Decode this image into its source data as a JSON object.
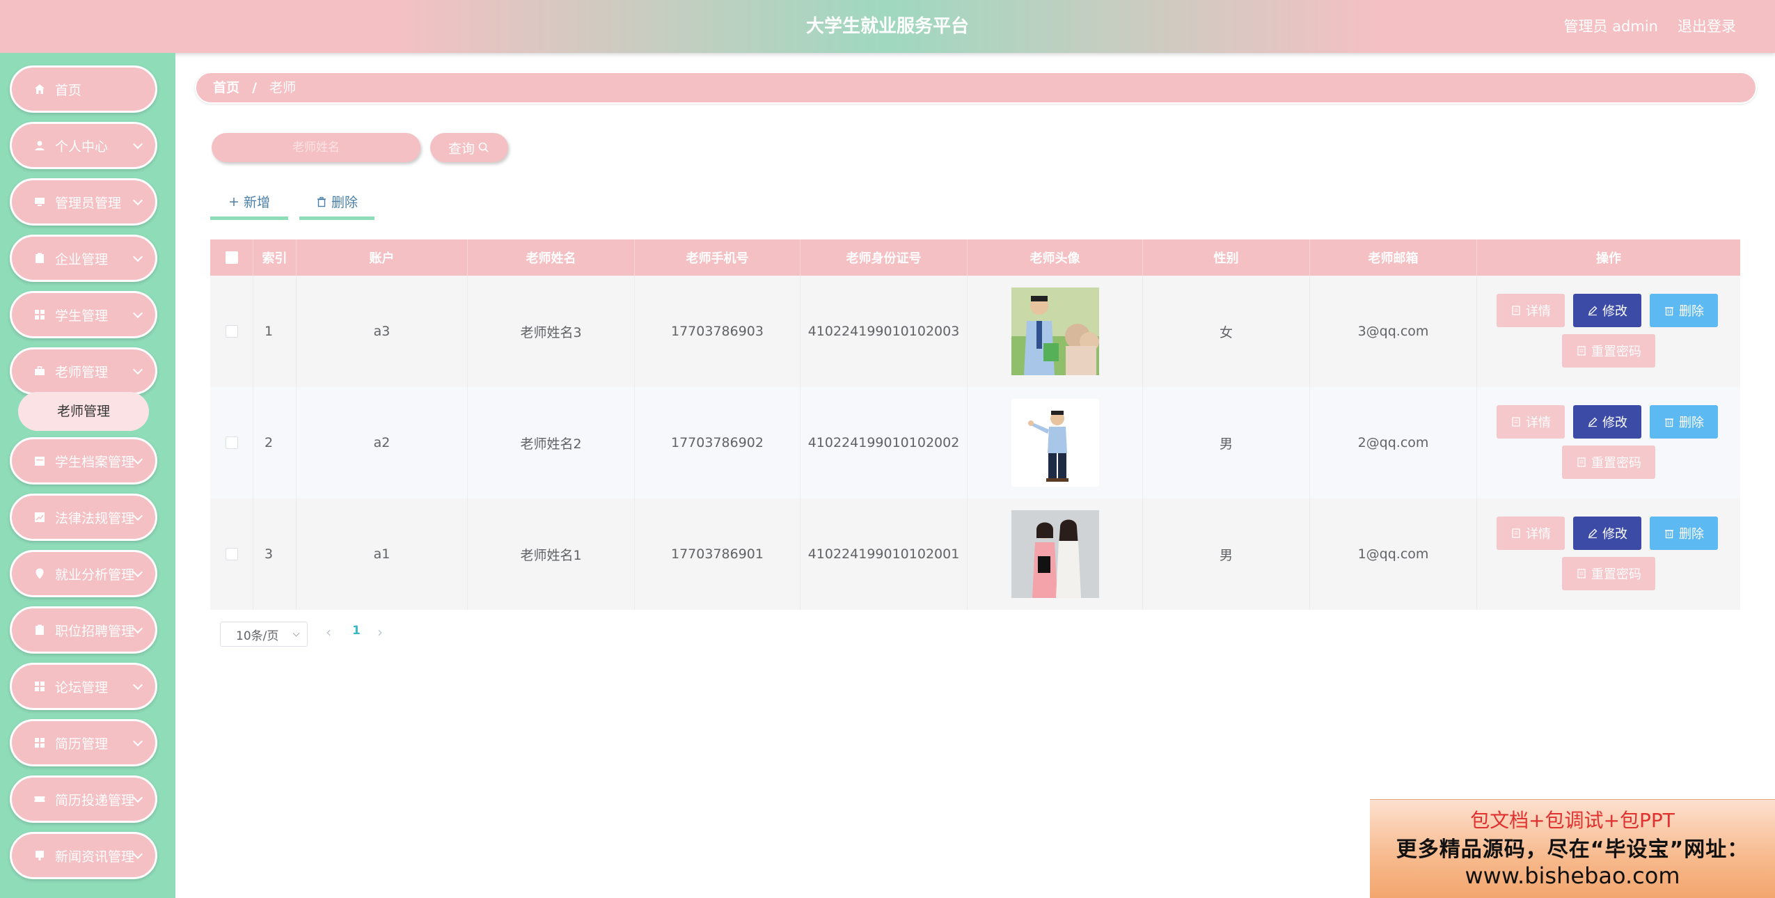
{
  "header": {
    "title": "大学生就业服务平台",
    "user": "管理员 admin",
    "logout": "退出登录"
  },
  "sidebar": {
    "items": [
      {
        "label": "首页",
        "icon": "home-icon",
        "has_children": false
      },
      {
        "label": "个人中心",
        "icon": "user-icon",
        "has_children": true
      },
      {
        "label": "管理员管理",
        "icon": "monitor-icon",
        "has_children": true
      },
      {
        "label": "企业管理",
        "icon": "clipboard-icon",
        "has_children": true
      },
      {
        "label": "学生管理",
        "icon": "grid-icon",
        "has_children": true
      },
      {
        "label": "老师管理",
        "icon": "briefcase-icon",
        "has_children": true
      },
      {
        "label": "学生档案管理",
        "icon": "calendar-icon",
        "has_children": true
      },
      {
        "label": "法律法规管理",
        "icon": "chart-icon",
        "has_children": true
      },
      {
        "label": "就业分析管理",
        "icon": "location-icon",
        "has_children": true
      },
      {
        "label": "职位招聘管理",
        "icon": "clipboard-icon",
        "has_children": true
      },
      {
        "label": "论坛管理",
        "icon": "grid-icon",
        "has_children": true
      },
      {
        "label": "简历管理",
        "icon": "grid-icon",
        "has_children": true
      },
      {
        "label": "简历投递管理",
        "icon": "ticket-icon",
        "has_children": true
      },
      {
        "label": "新闻资讯管理",
        "icon": "news-icon",
        "has_children": true
      }
    ],
    "active_submenu": "老师管理"
  },
  "breadcrumb": {
    "home": "首页",
    "separator": "/",
    "current": "老师"
  },
  "search": {
    "placeholder": "老师姓名",
    "button": "查询"
  },
  "toolbar": {
    "add": "新增",
    "delete": "删除"
  },
  "table": {
    "columns": [
      "索引",
      "账户",
      "老师姓名",
      "老师手机号",
      "老师身份证号",
      "老师头像",
      "性别",
      "老师邮箱",
      "操作"
    ],
    "rows": [
      {
        "index": "1",
        "account": "a3",
        "name": "老师姓名3",
        "phone": "17703786903",
        "id_card": "410224199010102003",
        "gender": "女",
        "email": "3@qq.com"
      },
      {
        "index": "2",
        "account": "a2",
        "name": "老师姓名2",
        "phone": "17703786902",
        "id_card": "410224199010102002",
        "gender": "男",
        "email": "2@qq.com"
      },
      {
        "index": "3",
        "account": "a1",
        "name": "老师姓名1",
        "phone": "17703786901",
        "id_card": "410224199010102001",
        "gender": "男",
        "email": "1@qq.com"
      }
    ],
    "actions": {
      "detail": "详情",
      "edit": "修改",
      "delete": "删除",
      "reset_password": "重置密码"
    }
  },
  "pagination": {
    "page_size": "10条/页",
    "current_page": "1",
    "prev": "‹",
    "next": "›"
  },
  "watermark": {
    "line1": "包文档+包调试+包PPT",
    "line2": "更多精品源码，尽在“毕设宝”网址：",
    "line3": "www.bishebao.com"
  },
  "colors": {
    "accent_pink": "#f5c0c3",
    "accent_green": "#8fdcb9",
    "edit_blue": "#3b4ba6",
    "delete_blue": "#5cb9f2",
    "page_active": "#3bb7c8"
  }
}
